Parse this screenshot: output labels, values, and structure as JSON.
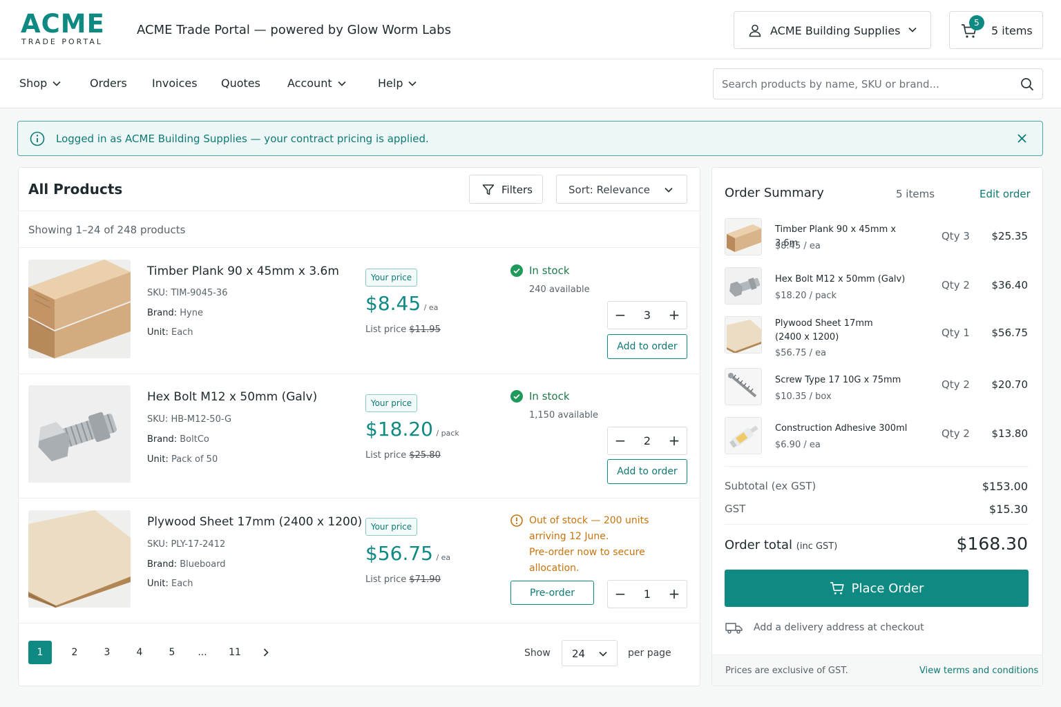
{
  "brand": {
    "name": "ACME",
    "sub": "TRADE PORTAL"
  },
  "header": {
    "title": "ACME Trade Portal — powered by Glow Worm Labs",
    "account_label": "ACME Building Supplies",
    "cart_count": "5",
    "cart_label": "5 items"
  },
  "nav": {
    "items": [
      {
        "label": "Shop",
        "has_menu": true
      },
      {
        "label": "Orders",
        "has_menu": false
      },
      {
        "label": "Invoices",
        "has_menu": false
      },
      {
        "label": "Quotes",
        "has_menu": false
      },
      {
        "label": "Account",
        "has_menu": true
      },
      {
        "label": "Help",
        "has_menu": true
      }
    ],
    "search_placeholder": "Search products by name, SKU or brand..."
  },
  "banner": {
    "text": "Logged in as ACME Building Supplies — your contract pricing is applied."
  },
  "products": {
    "title": "All Products",
    "filters_label": "Filters",
    "sort_label": "Sort: Relevance",
    "showing": "Showing 1–24 of 248 products",
    "items": [
      {
        "name": "Timber Plank 90 x 45mm x 3.6m",
        "sku_label": "SKU:",
        "sku": "TIM-9045-36",
        "brand_label": "Brand:",
        "brand": "Hyne",
        "unit_label": "Unit:",
        "unit": "Each",
        "your_price_label": "Your price",
        "price": "$8.45",
        "price_unit": "/ ea",
        "list_label": "List price",
        "list_price": "$11.95",
        "stock_status": "In stock",
        "stock_detail": "240 available",
        "qty": "3",
        "action": "Add to order"
      },
      {
        "name": "Hex Bolt M12 x 50mm (Galv)",
        "sku_label": "SKU:",
        "sku": "HB-M12-50-G",
        "brand_label": "Brand:",
        "brand": "BoltCo",
        "unit_label": "Unit:",
        "unit": "Pack of 50",
        "your_price_label": "Your price",
        "price": "$18.20",
        "price_unit": "/ pack",
        "list_label": "List price",
        "list_price": "$25.80",
        "stock_status": "In stock",
        "stock_detail": "1,150 available",
        "qty": "2",
        "action": "Add to order"
      },
      {
        "name": "Plywood Sheet 17mm (2400 x 1200)",
        "sku_label": "SKU:",
        "sku": "PLY-17-2412",
        "brand_label": "Brand:",
        "brand": "Blueboard",
        "unit_label": "Unit:",
        "unit": "Each",
        "your_price_label": "Your price",
        "price": "$56.75",
        "price_unit": "/ ea",
        "list_label": "List price",
        "list_price": "$71.90",
        "stock_lines": [
          "Out of stock — 200 units",
          "arriving 12 June.",
          "Pre-order now to secure",
          "allocation."
        ],
        "qty": "1",
        "action": "Pre-order"
      }
    ],
    "pagination": {
      "pages": [
        "1",
        "2",
        "3",
        "4",
        "5",
        "...",
        "11"
      ],
      "current": "1",
      "show_label": "Show",
      "per_page_value": "24",
      "per_page_label": "per page"
    }
  },
  "summary": {
    "title": "Order Summary",
    "count": "5 items",
    "edit_label": "Edit order",
    "lines": [
      {
        "name": "Timber Plank 90 x 45mm x 3.6m",
        "unit_price": "$8.45 / ea",
        "qty": "Qty 3",
        "total": "$25.35"
      },
      {
        "name": "Hex Bolt M12 x 50mm (Galv)",
        "unit_price": "$18.20 / pack",
        "qty": "Qty 2",
        "total": "$36.40"
      },
      {
        "name_lines": [
          "Plywood Sheet 17mm",
          "(2400 x 1200)"
        ],
        "unit_price": "$56.75 / ea",
        "qty": "Qty 1",
        "total": "$56.75"
      },
      {
        "name": "Screw Type 17  10G x 75mm",
        "unit_price": "$10.35 / box",
        "qty": "Qty 2",
        "total": "$20.70"
      },
      {
        "name": "Construction Adhesive 300ml",
        "unit_price": "$6.90 / ea",
        "qty": "Qty 2",
        "total": "$13.80"
      }
    ],
    "subtotal_label": "Subtotal (ex GST)",
    "subtotal": "$153.00",
    "gst_label": "GST",
    "gst": "$15.30",
    "total_label": "Order total",
    "total_note": "(inc GST)",
    "total": "$168.30",
    "place_order": "Place Order",
    "delivery_note": "Add a delivery address at checkout",
    "footer_note": "Prices are exclusive of GST.",
    "terms_link": "View terms and conditions"
  },
  "colors": {
    "accent": "#0e8a82",
    "success": "#1f7a4a",
    "warning": "#c7730e"
  }
}
